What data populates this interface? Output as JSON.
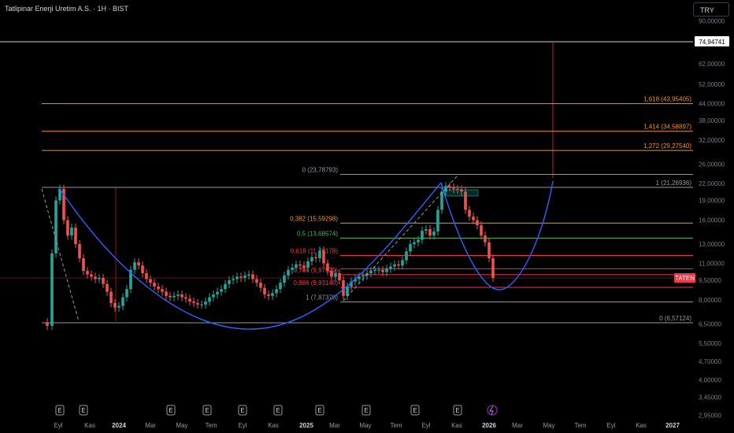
{
  "header": {
    "title": "Tatlipinar Enerji Uretim A.S. · 1H · BIST",
    "currency": "TRY"
  },
  "chart_data": {
    "type": "candlestick",
    "y_scale": "log",
    "ylim": [
      2.95,
      90.0
    ],
    "y_ticks": [
      "90,00000",
      "62,00000",
      "52,00000",
      "44,00000",
      "38,00000",
      "32,00000",
      "26,00000",
      "22,00000",
      "19,00000",
      "16,00000",
      "13,00000",
      "11,00000",
      "9,50000",
      "8,00000",
      "6,50000",
      "5,50000",
      "4,70000",
      "4,00000",
      "3,45000",
      "2,95000"
    ],
    "x_ticks": [
      "Eyl",
      "Kas",
      "2024",
      "Mar",
      "May",
      "Tem",
      "Eyl",
      "Kas",
      "2025",
      "Mar",
      "May",
      "Tem",
      "Eyl",
      "Kas",
      "2026",
      "Mar",
      "May",
      "Tem",
      "Eyl",
      "Kas",
      "2027"
    ],
    "price_labels": [
      {
        "text": "74,94741",
        "value": 74.94741,
        "style": "current"
      },
      {
        "text": "TATEN",
        "value": 9.7,
        "style": "symbol"
      }
    ],
    "fib_levels": [
      {
        "label": "1,618 (43,95405)",
        "value": 43.95405,
        "color": "#f7931a"
      },
      {
        "label": "1,414 (34,58897)",
        "value": 34.58897,
        "color": "#f7931a"
      },
      {
        "label": "1,272 (29,27540)",
        "value": 29.2754,
        "color": "#f7931a"
      },
      {
        "label": "0 (23,78793)",
        "value": 23.78793,
        "color": "#9598a1"
      },
      {
        "label": "1 (21,26936)",
        "value": 21.26936,
        "color": "#9598a1"
      },
      {
        "label": "0,382 (15,59298)",
        "value": 15.59298,
        "color": "#f7931a"
      },
      {
        "label": "0,5 (13,68574)",
        "value": 13.68574,
        "color": "#4caf50"
      },
      {
        "label": "0,618 (11,78178)",
        "value": 11.78178,
        "color": "#f23645"
      },
      {
        "label": "0,706 (10,5)",
        "value": 10.5,
        "color": "#f23645"
      },
      {
        "label": "0,786 (9,97529)",
        "value": 9.97529,
        "color": "#f23645"
      },
      {
        "label": "0,886 (8,93140)",
        "value": 8.9314,
        "color": "#f23645"
      },
      {
        "label": "1 (7,87370)",
        "value": 7.8737,
        "color": "#9598a1"
      },
      {
        "label": "0 (6,57124)",
        "value": 6.57124,
        "color": "#9598a1"
      }
    ],
    "events": [
      "E",
      "E",
      "E",
      "E",
      "E",
      "E",
      "E",
      "E",
      "E",
      "E"
    ],
    "colors": {
      "up": "#26a69a",
      "down": "#ef5350",
      "curve": "#2962ff"
    }
  }
}
